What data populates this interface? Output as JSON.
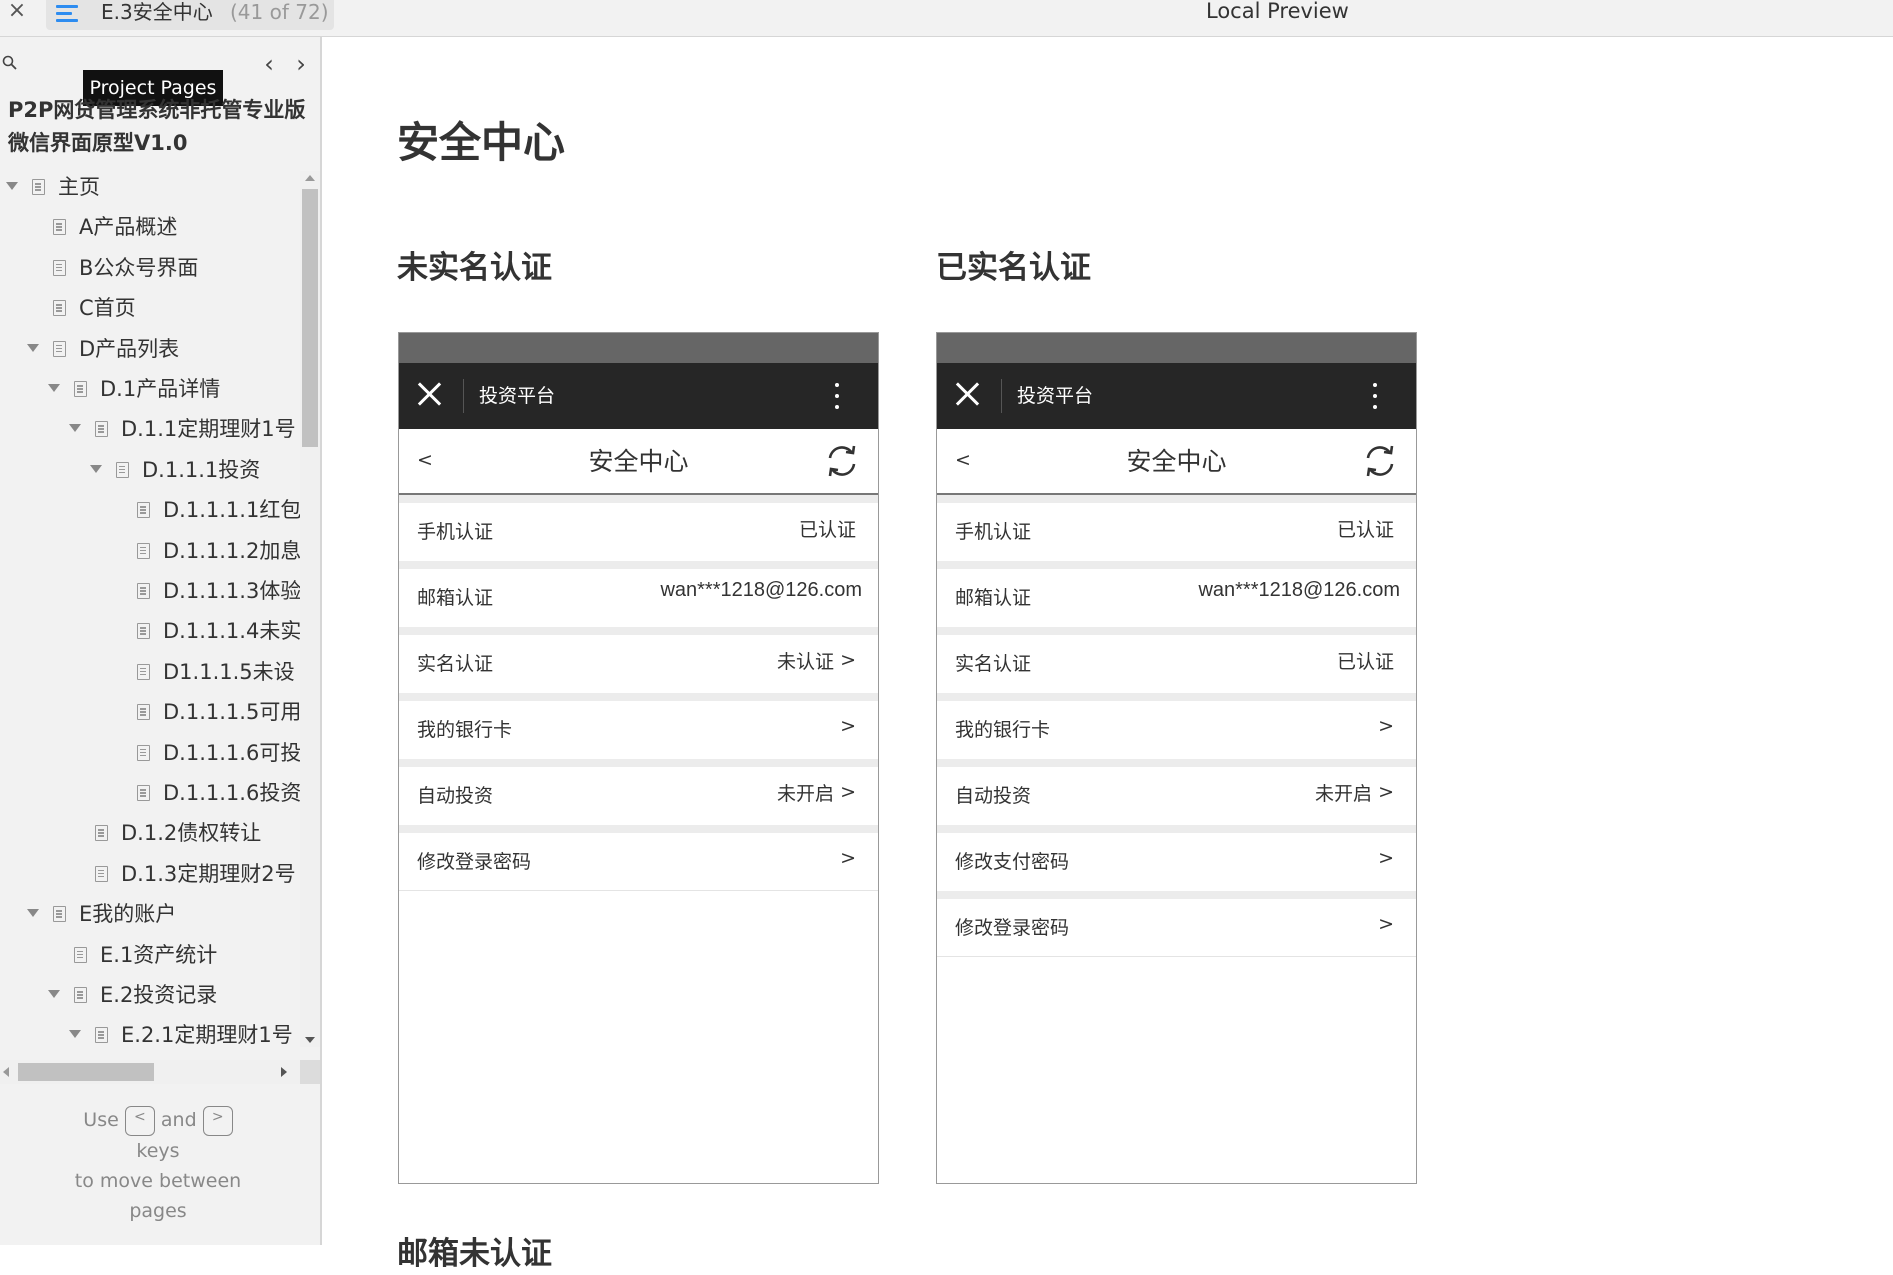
{
  "topbar": {
    "close_glyph": "×",
    "page_name": "E.3安全中心",
    "page_count": "(41 of 72)",
    "preview_title": "Local Preview"
  },
  "sidebar": {
    "tooltip": "Project Pages",
    "prev_glyph": "‹",
    "next_glyph": "›",
    "project_title_line1": "P2P网贷管理系统非托管专业版",
    "project_title_line2": "微信界面原型V1.0",
    "tree": [
      {
        "label": "主页",
        "level": 0,
        "expanded": true
      },
      {
        "label": "A产品概述",
        "level": 1,
        "expanded": false
      },
      {
        "label": "B公众号界面",
        "level": 1,
        "expanded": false
      },
      {
        "label": "C首页",
        "level": 1,
        "expanded": false
      },
      {
        "label": "D产品列表",
        "level": 1,
        "expanded": true
      },
      {
        "label": "D.1产品详情",
        "level": 2,
        "expanded": true
      },
      {
        "label": "D.1.1定期理财1号",
        "level": 3,
        "expanded": true
      },
      {
        "label": "D.1.1.1投资",
        "level": 4,
        "expanded": true
      },
      {
        "label": "D.1.1.1.1红包",
        "level": 5,
        "expanded": false
      },
      {
        "label": "D.1.1.1.2加息",
        "level": 5,
        "expanded": false
      },
      {
        "label": "D.1.1.1.3体验",
        "level": 5,
        "expanded": false
      },
      {
        "label": "D.1.1.1.4未实",
        "level": 5,
        "expanded": false
      },
      {
        "label": "D1.1.1.5未设",
        "level": 5,
        "expanded": false
      },
      {
        "label": "D.1.1.1.5可用",
        "level": 5,
        "expanded": false
      },
      {
        "label": "D.1.1.1.6可投",
        "level": 5,
        "expanded": false
      },
      {
        "label": "D.1.1.1.6投资",
        "level": 5,
        "expanded": false
      },
      {
        "label": "D.1.2债权转让",
        "level": 3,
        "expanded": false
      },
      {
        "label": "D.1.3定期理财2号",
        "level": 3,
        "expanded": false
      },
      {
        "label": "E我的账户",
        "level": 1,
        "expanded": true
      },
      {
        "label": "E.1资产统计",
        "level": 2,
        "expanded": false
      },
      {
        "label": "E.2投资记录",
        "level": 2,
        "expanded": true
      },
      {
        "label": "E.2.1定期理财1号",
        "level": 3,
        "expanded": true
      }
    ],
    "hint": {
      "use": "Use",
      "key_prev": "<",
      "and": "and",
      "key_next": ">",
      "keys": "keys",
      "line2": "to move between",
      "line3": "pages"
    }
  },
  "main": {
    "page_title": "安全中心",
    "section_left": "未实名认证",
    "section_right": "已实名认证",
    "next_section_partial": "邮箱未认证",
    "phone": {
      "app_title": "投资平台",
      "back_glyph": "<",
      "header_title": "安全中心"
    },
    "left_rows": [
      {
        "label": "手机认证",
        "value": "已认证",
        "arrow": ""
      },
      {
        "label": "邮箱认证",
        "value": "wan***1218@126.com",
        "arrow": ""
      },
      {
        "label": "实名认证",
        "value": "未认证",
        "arrow": ">"
      },
      {
        "label": "我的银行卡",
        "value": "",
        "arrow": ">"
      },
      {
        "label": "自动投资",
        "value": "未开启",
        "arrow": ">"
      },
      {
        "label": "修改登录密码",
        "value": "",
        "arrow": ">"
      }
    ],
    "right_rows": [
      {
        "label": "手机认证",
        "value": "已认证",
        "arrow": ""
      },
      {
        "label": "邮箱认证",
        "value": "wan***1218@126.com",
        "arrow": ""
      },
      {
        "label": "实名认证",
        "value": "已认证",
        "arrow": ""
      },
      {
        "label": "我的银行卡",
        "value": "",
        "arrow": ">"
      },
      {
        "label": "自动投资",
        "value": "未开启",
        "arrow": ">"
      },
      {
        "label": "修改支付密码",
        "value": "",
        "arrow": ">"
      },
      {
        "label": "修改登录密码",
        "value": "",
        "arrow": ">"
      }
    ]
  },
  "colors": {
    "accent": "#2d8cf0",
    "appbar": "#262626",
    "statusbar": "#666666"
  }
}
